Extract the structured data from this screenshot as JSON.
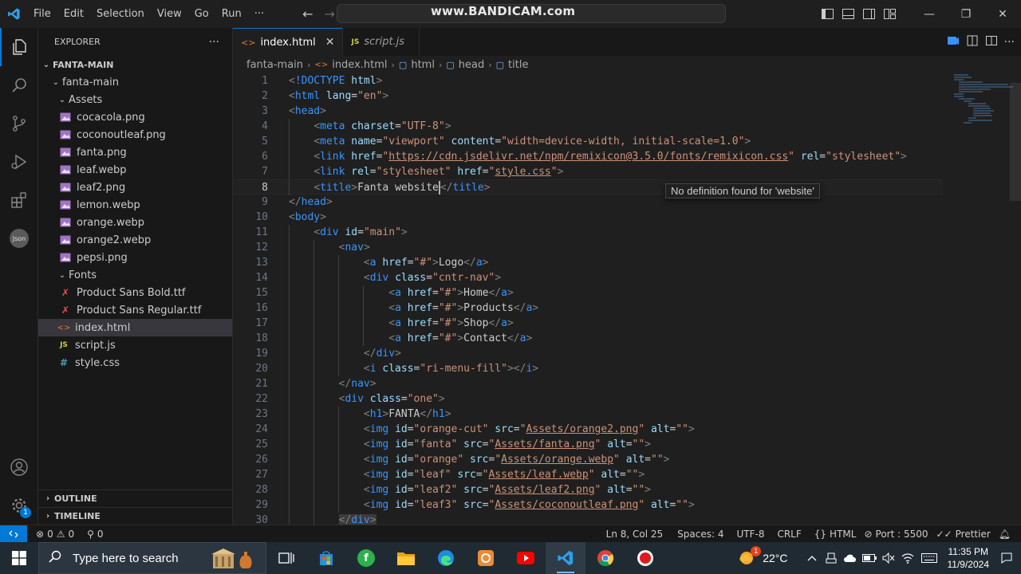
{
  "titlebar": {
    "menu": [
      "File",
      "Edit",
      "Selection",
      "View",
      "Go",
      "Run",
      "···"
    ],
    "watermark": "www.BANDICAM.com",
    "window_controls": [
      "—",
      "❐",
      "✕"
    ]
  },
  "sidebar": {
    "header": "EXPLORER",
    "more": "···",
    "root": "FANTA-MAIN",
    "folder": "fanta-main",
    "assets_folder": "Assets",
    "assets": [
      "cocacola.png",
      "coconoutleaf.png",
      "fanta.png",
      "leaf.webp",
      "leaf2.png",
      "lemon.webp",
      "orange.webp",
      "orange2.webp",
      "pepsi.png"
    ],
    "fonts_folder": "Fonts",
    "fonts": [
      "Product Sans Bold.ttf",
      "Product Sans Regular.ttf"
    ],
    "files": [
      "index.html",
      "script.js",
      "style.css"
    ],
    "outline": "OUTLINE",
    "timeline": "TIMELINE"
  },
  "activity": {
    "json_label": "Json",
    "settings_badge": "1"
  },
  "tabs": [
    {
      "label": "index.html",
      "close": "✕"
    },
    {
      "label": "script.js"
    }
  ],
  "breadcrumb": [
    "fanta-main",
    "index.html",
    "html",
    "head",
    "title"
  ],
  "hover": "No definition found for 'website'",
  "code": {
    "l3": "https://cdn.jsdelivr.net/npm/remixicon@3.5.0/fonts/remixicon.css"
  },
  "statusbar": {
    "errors": "0",
    "warnings": "0",
    "ports": "0",
    "position": "Ln 8, Col 25",
    "spaces": "Spaces: 4",
    "encoding": "UTF-8",
    "eol": "CRLF",
    "language": "HTML",
    "port": "Port : 5500",
    "prettier": "Prettier"
  },
  "taskbar": {
    "search_placeholder": "Type here to search",
    "temperature": "22°C",
    "weather_badge": "1",
    "time": "11:35 PM",
    "date": "11/9/2024"
  }
}
